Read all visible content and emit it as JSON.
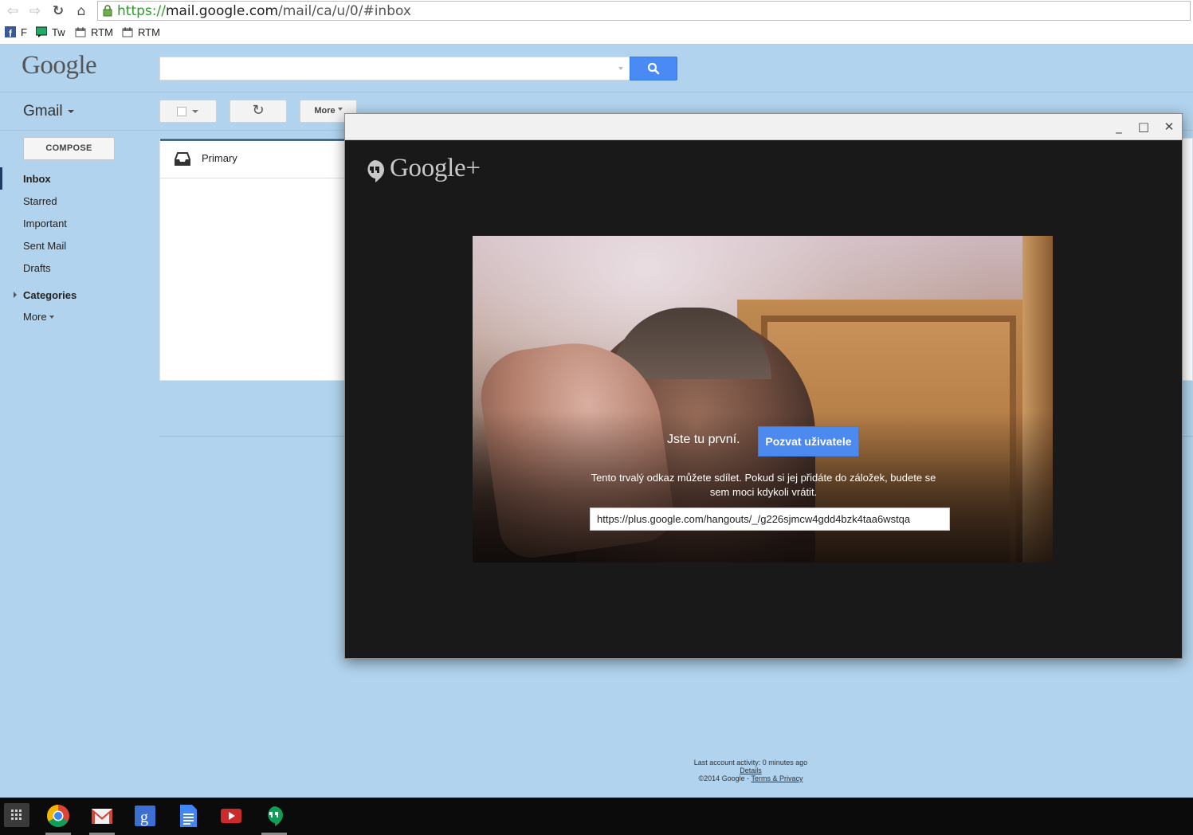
{
  "browser": {
    "url_scheme": "https://",
    "url_host": "mail.google.com",
    "url_path": "/mail/ca/u/0/#inbox",
    "bookmarks": [
      {
        "label": "F",
        "icon": "facebook-icon"
      },
      {
        "label": "Tw",
        "icon": "twitter-chat-icon"
      },
      {
        "label": "RTM",
        "icon": "calendar-icon"
      },
      {
        "label": "RTM",
        "icon": "calendar-icon"
      }
    ]
  },
  "header": {
    "logo": "Google",
    "search_placeholder": "",
    "app_switch_label": "Gmail"
  },
  "toolbar": {
    "more_label": "More"
  },
  "sidebar": {
    "compose_label": "COMPOSE",
    "items": [
      {
        "label": "Inbox",
        "active": true
      },
      {
        "label": "Starred"
      },
      {
        "label": "Important"
      },
      {
        "label": "Sent Mail"
      },
      {
        "label": "Drafts"
      }
    ],
    "categories_label": "Categories",
    "more_label": "More"
  },
  "inbox": {
    "tabs": [
      {
        "label": "Primary"
      }
    ]
  },
  "footer": {
    "activity": "Last account activity: 0 minutes ago",
    "details": "Details",
    "copyright": "©2014 Google - ",
    "terms": "Terms & Privacy"
  },
  "hangout": {
    "logo": "Google+",
    "first_text": "Jste tu první.",
    "invite_label": "Pozvat uživatele",
    "share_text": "Tento trvalý odkaz můžete sdílet. Pokud si jej přidáte do záložek, budete se sem moci kdykoli vrátit.",
    "link": "https://plus.google.com/hangouts/_/g226sjmcw4gdd4bzk4taa6wstqa"
  },
  "colors": {
    "page_bg": "#b1d3ed",
    "accent_blue": "#4a8af4",
    "hangout_bg": "#191919"
  },
  "taskbar": {
    "apps": [
      "chrome-icon",
      "gmail-icon",
      "google-search-icon",
      "docs-icon",
      "youtube-icon",
      "hangouts-icon"
    ]
  }
}
